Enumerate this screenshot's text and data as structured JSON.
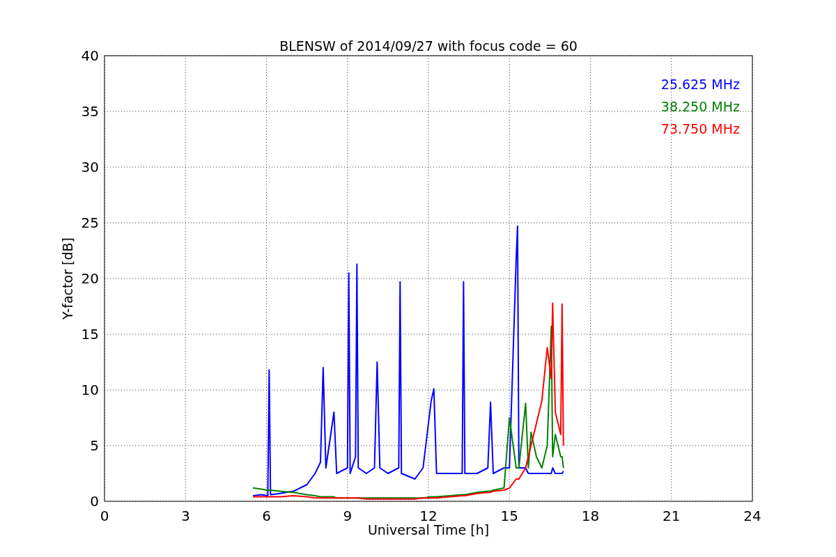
{
  "plot": {
    "chart_data": {
      "type": "line",
      "title": "BLENSW of 2014/09/27 with focus code = 60",
      "xlabel": "Universal Time [h]",
      "ylabel": "Y-factor [dB]",
      "x": [
        5.5,
        5.8,
        6.05,
        6.1,
        6.15,
        6.5,
        7.0,
        7.5,
        7.8,
        8.0,
        8.1,
        8.2,
        8.5,
        8.6,
        9.0,
        9.05,
        9.1,
        9.3,
        9.35,
        9.4,
        9.7,
        10.0,
        10.1,
        10.2,
        10.5,
        10.9,
        10.95,
        11.0,
        11.5,
        11.8,
        12.1,
        12.2,
        12.3,
        12.8,
        13.25,
        13.3,
        13.35,
        13.8,
        14.2,
        14.3,
        14.4,
        14.8,
        15.0,
        15.25,
        15.3,
        15.35,
        15.6,
        15.7,
        15.8,
        16.0,
        16.2,
        16.4,
        16.55,
        16.6,
        16.7,
        16.9,
        16.95,
        17.0
      ],
      "series": [
        {
          "name": "25.625 MHz",
          "color": "#0000ff",
          "values": [
            0.5,
            0.6,
            0.5,
            11.8,
            0.6,
            0.7,
            0.9,
            1.5,
            2.5,
            3.5,
            12.0,
            3,
            8.0,
            2.5,
            3,
            20.5,
            2.5,
            4,
            21.3,
            3,
            2.5,
            3,
            12.5,
            3,
            2.5,
            3,
            19.7,
            2.5,
            2,
            3,
            9,
            10.1,
            2.5,
            2.5,
            2.5,
            19.7,
            2.5,
            2.5,
            3,
            8.9,
            2.5,
            3,
            3,
            21.8,
            24.7,
            3,
            3,
            2.5,
            2.5,
            2.5,
            2.5,
            2.5,
            2.5,
            3,
            2.5,
            2.5,
            2.5,
            2.7
          ]
        },
        {
          "name": "38.250 MHz",
          "color": "#008000",
          "values": [
            1.2,
            1.1,
            1.0,
            1.0,
            1.0,
            0.9,
            0.8,
            0.6,
            0.5,
            0.4,
            0.4,
            0.4,
            0.4,
            0.3,
            0.3,
            0.3,
            0.3,
            0.3,
            0.3,
            0.3,
            0.3,
            0.3,
            0.3,
            0.3,
            0.3,
            0.3,
            0.3,
            0.3,
            0.3,
            0.3,
            0.4,
            0.4,
            0.4,
            0.5,
            0.6,
            0.6,
            0.6,
            0.8,
            0.9,
            0.9,
            1.0,
            1.2,
            7.5,
            3,
            3,
            3,
            8.8,
            3,
            6.2,
            4,
            3,
            5,
            15.7,
            4,
            6,
            4,
            4,
            3
          ]
        },
        {
          "name": "73.750 MHz",
          "color": "#ff0000",
          "values": [
            0.4,
            0.4,
            0.4,
            0.4,
            0.4,
            0.4,
            0.5,
            0.4,
            0.3,
            0.3,
            0.3,
            0.3,
            0.3,
            0.3,
            0.3,
            0.3,
            0.3,
            0.3,
            0.3,
            0.3,
            0.2,
            0.2,
            0.2,
            0.2,
            0.2,
            0.2,
            0.2,
            0.2,
            0.2,
            0.3,
            0.3,
            0.3,
            0.3,
            0.4,
            0.5,
            0.5,
            0.5,
            0.7,
            0.8,
            0.8,
            0.9,
            1.0,
            1.2,
            2,
            2,
            2,
            3,
            4,
            5,
            7,
            9,
            13.8,
            11,
            17.8,
            8,
            6,
            17.7,
            5
          ]
        }
      ],
      "grid": true,
      "xlim": [
        0,
        24
      ],
      "ylim": [
        0,
        40
      ],
      "xticks": [
        0,
        3,
        6,
        9,
        12,
        15,
        18,
        21,
        24
      ],
      "yticks": [
        0,
        5,
        10,
        15,
        20,
        25,
        30,
        35,
        40
      ]
    }
  }
}
